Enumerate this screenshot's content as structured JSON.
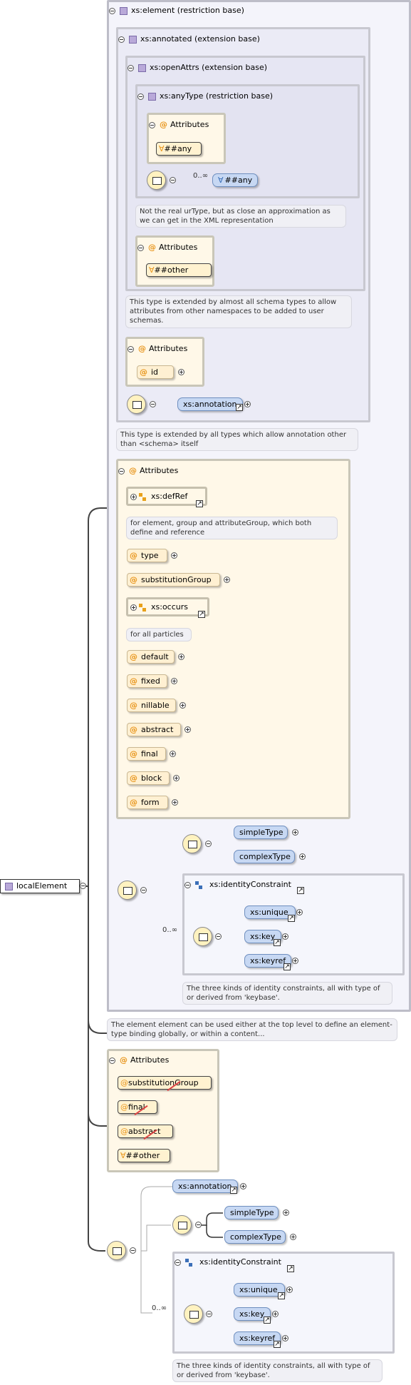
{
  "root": {
    "label": "localElement"
  },
  "element_group": {
    "title": "xs:element (restriction base)"
  },
  "annotated_group": {
    "title": "xs:annotated (extension base)"
  },
  "openattrs_group": {
    "title": "xs:openAttrs (extension base)"
  },
  "anytype_group": {
    "title": "xs:anyType (restriction base)",
    "attributes_title": "Attributes",
    "attr_any": "##any",
    "seq_cardinality": "0..∞",
    "any_element": "##any"
  },
  "notes": {
    "anytype": "Not the real urType, but as close an approximation as we can get in the XML representation",
    "openattrs": "This type is extended by almost all schema types to allow attributes from other namespaces to be added to user schemas.",
    "annotated": "This type is extended by all types which allow annotation other than <schema> itself",
    "defref": "for element, group and attributeGroup, which both define and reference",
    "occurs": "for all particles",
    "identity1": "The three kinds of identity constraints, all with type of or derived from 'keybase'.",
    "element": "The element element can be used either at the top level to define an element-type binding globally, or within a content...",
    "identity2": "The three kinds of identity constraints, all with type of or derived from 'keybase'."
  },
  "openattrs_attrs": {
    "title": "Attributes",
    "other": "##other"
  },
  "annotated_attrs": {
    "title": "Attributes",
    "id": "id",
    "annotation": "xs:annotation"
  },
  "element_attrs": {
    "title": "Attributes",
    "defref": "xs:defRef",
    "type": "type",
    "substitutionGroup": "substitutionGroup",
    "occurs": "xs:occurs",
    "default": "default",
    "fixed": "fixed",
    "nillable": "nillable",
    "abstract": "abstract",
    "final": "final",
    "block": "block",
    "form": "form"
  },
  "element_content": {
    "simpleType": "simpleType",
    "complexType": "complexType",
    "cardinality": "0..∞",
    "identity_title": "xs:identityConstraint",
    "unique": "xs:unique",
    "key": "xs:key",
    "keyref": "xs:keyref"
  },
  "local_attrs": {
    "title": "Attributes",
    "substitutionGroup": "substitutionGroup",
    "final": "final",
    "abstract": "abstract",
    "other": "##other"
  },
  "local_content": {
    "annotation": "xs:annotation",
    "simpleType": "simpleType",
    "complexType": "complexType",
    "cardinality": "0..∞",
    "identity_title": "xs:identityConstraint",
    "unique": "xs:unique",
    "key": "xs:key",
    "keyref": "xs:keyref"
  }
}
